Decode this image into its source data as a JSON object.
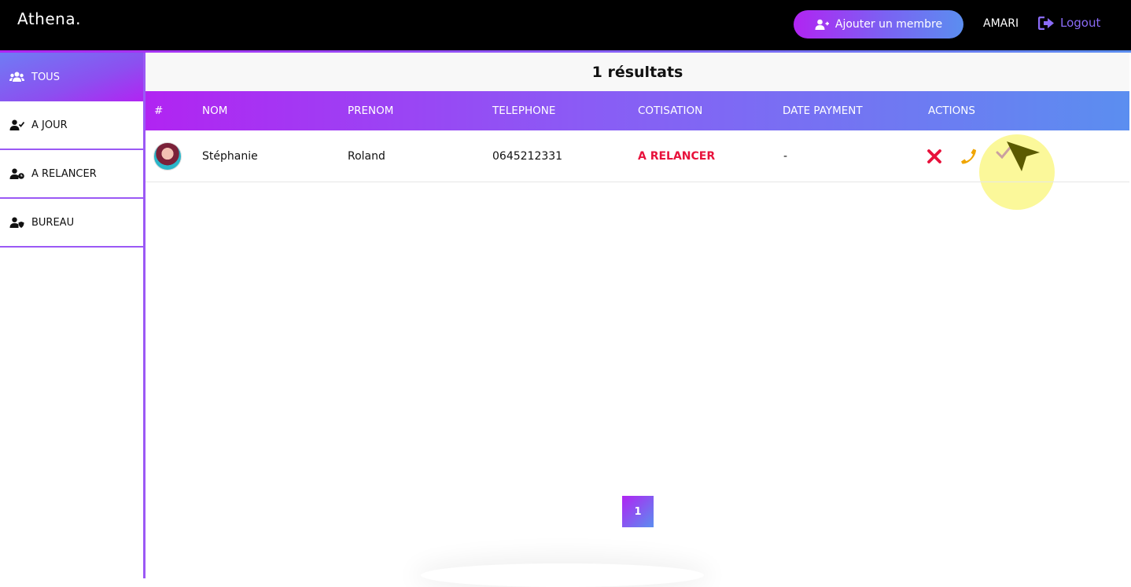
{
  "app": {
    "brand": "Athena."
  },
  "topbar": {
    "add_member_label": "Ajouter un membre",
    "username": "AMARI",
    "logout_label": "Logout"
  },
  "sidebar": {
    "items": [
      {
        "label": "TOUS",
        "icon": "users-icon",
        "active": true
      },
      {
        "label": "A JOUR",
        "icon": "user-check-icon",
        "active": false
      },
      {
        "label": "A RELANCER",
        "icon": "user-clock-icon",
        "active": false
      },
      {
        "label": "BUREAU",
        "icon": "user-shield-icon",
        "active": false
      }
    ]
  },
  "results": {
    "count_label": "1 résultats"
  },
  "table": {
    "headers": [
      "#",
      "NOM",
      "PRENOM",
      "TELEPHONE",
      "COTISATION",
      "DATE PAYMENT",
      "ACTIONS"
    ],
    "rows": [
      {
        "avatar": "avatar-photo",
        "nom": "Stéphanie",
        "prenom": "Roland",
        "telephone": "0645212331",
        "cotisation": "A RELANCER",
        "date_payment": "-",
        "actions": [
          "delete-icon",
          "phone-icon",
          "check-icon"
        ]
      }
    ]
  },
  "pagination": {
    "current_page": "1"
  },
  "colors": {
    "gradient_start": "#b124f2",
    "gradient_end": "#5b8ef0",
    "status_late": "#e8123c",
    "delete": "#e8123c",
    "phone": "#f0a500",
    "logout": "#8a6bf7"
  }
}
